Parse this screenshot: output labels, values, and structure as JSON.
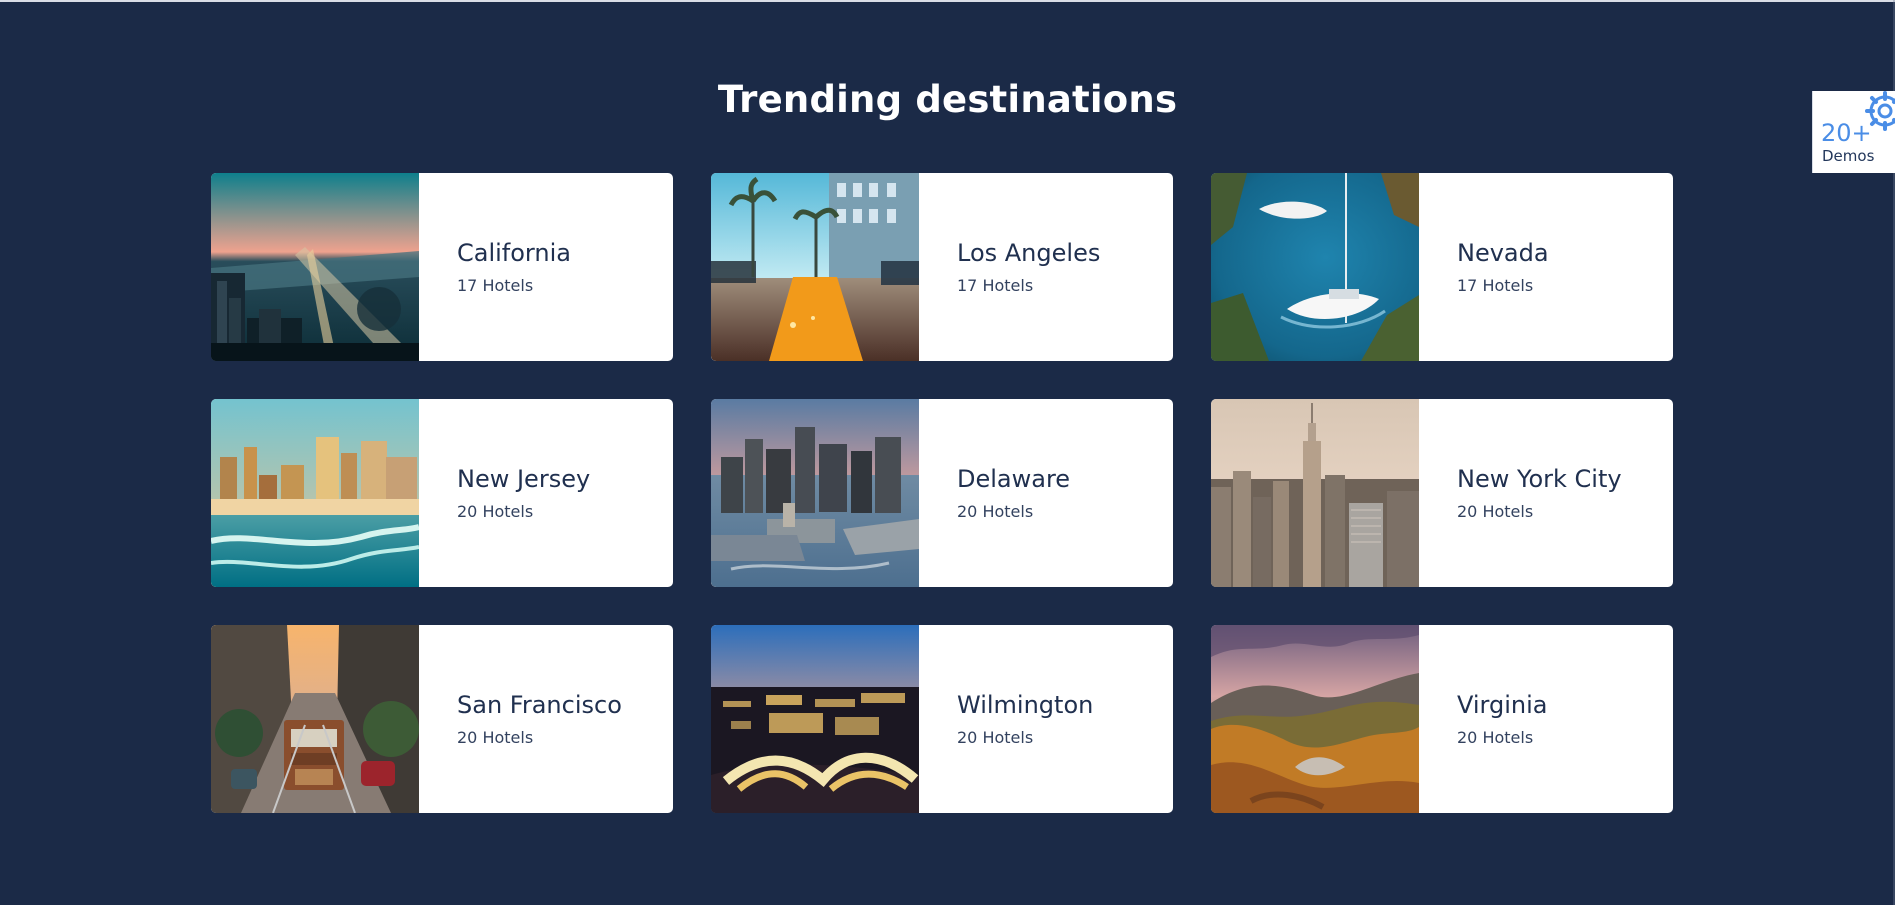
{
  "section": {
    "title": "Trending destinations"
  },
  "destinations": [
    {
      "name": "California",
      "hotels": "17 Hotels",
      "image": "bay-bridge-sunset-image"
    },
    {
      "name": "Los Angeles",
      "hotels": "17 Hotels",
      "image": "palm-street-image"
    },
    {
      "name": "Nevada",
      "hotels": "17 Hotels",
      "image": "sailboat-water-image"
    },
    {
      "name": "New Jersey",
      "hotels": "20 Hotels",
      "image": "beach-skyline-image"
    },
    {
      "name": "Delaware",
      "hotels": "20 Hotels",
      "image": "harbor-city-image"
    },
    {
      "name": "New York City",
      "hotels": "20 Hotels",
      "image": "empire-state-skyline-image"
    },
    {
      "name": "San Francisco",
      "hotels": "20 Hotels",
      "image": "cable-car-street-image"
    },
    {
      "name": "Wilmington",
      "hotels": "20 Hotels",
      "image": "fountain-night-image"
    },
    {
      "name": "Virginia",
      "hotels": "20 Hotels",
      "image": "autumn-mountains-image"
    }
  ],
  "demo_widget": {
    "count": "20+",
    "label": "Demos",
    "icon": "gear-icon",
    "accent": "#4a8de6"
  },
  "colors": {
    "background": "#1b2a47",
    "card": "#ffffff",
    "text": "#20304f"
  }
}
